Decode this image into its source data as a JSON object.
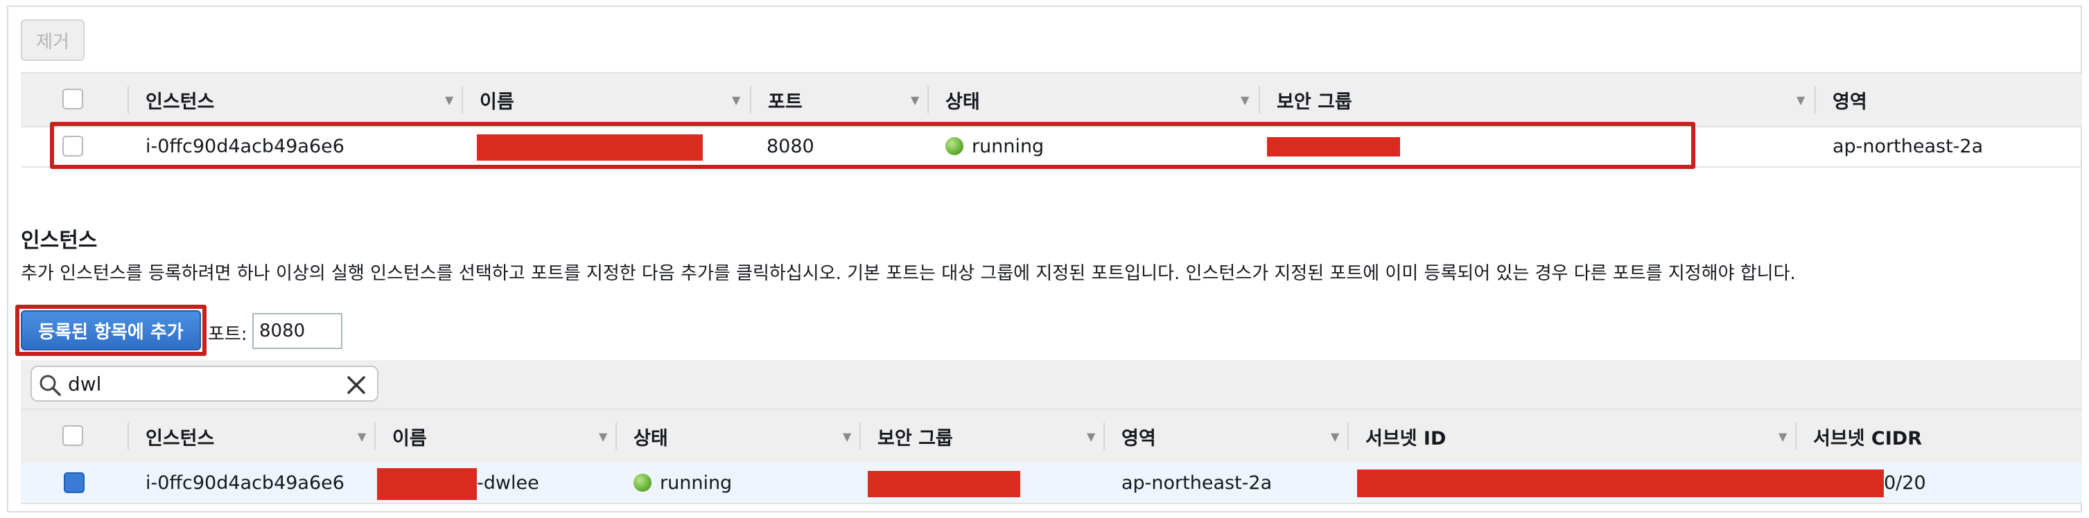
{
  "top": {
    "remove_label": "제거",
    "headers": [
      "인스턴스",
      "이름",
      "포트",
      "상태",
      "보안 그룹",
      "영역"
    ],
    "row": {
      "instance": "i-0ffc90d4acb49a6e6",
      "port": "8080",
      "status": "running",
      "zone": "ap-northeast-2a"
    }
  },
  "section": {
    "title": "인스턴스",
    "description": "추가 인스턴스를 등록하려면 하나 이상의 실행 인스턴스를 선택하고 포트를 지정한 다음 추가를 클릭하십시오. 기본 포트는 대상 그룹에 지정된 포트입니다. 인스턴스가 지정된 포트에 이미 등록되어 있는 경우 다른 포트를 지정해야 합니다.",
    "add_button": "등록된 항목에 추가",
    "port_label": "포트:",
    "port_value": "8080",
    "search_value": "dwl"
  },
  "bottom": {
    "headers": [
      "인스턴스",
      "이름",
      "상태",
      "보안 그룹",
      "영역",
      "서브넷 ID",
      "서브넷 CIDR"
    ],
    "row": {
      "instance": "i-0ffc90d4acb49a6e6",
      "name_suffix": "-dwlee",
      "status": "running",
      "zone": "ap-northeast-2a",
      "cidr_suffix": "0/20",
      "checked": true
    }
  },
  "colors": {
    "accent": "#2f6fc6",
    "redaction": "#db2a20",
    "highlight_box": "#c8201c",
    "running": "#5aa52a"
  },
  "icons": [
    "search-icon",
    "clear-icon",
    "sort-caret-icon",
    "status-running-icon"
  ]
}
